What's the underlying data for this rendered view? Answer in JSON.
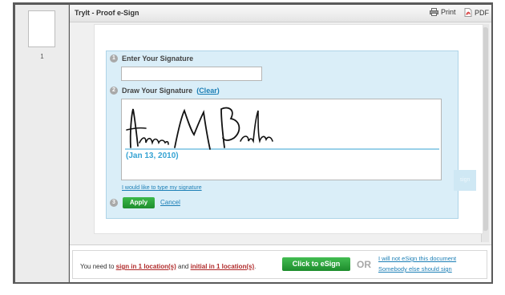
{
  "window": {
    "title": "TryIt - Proof e-Sign",
    "print_label": "Print",
    "pdf_label": "PDF"
  },
  "thumbnails": [
    {
      "page_number": "1"
    }
  ],
  "form": {
    "step1": {
      "number": "1",
      "label": "Enter Your Signature",
      "value": ""
    },
    "step2": {
      "number": "2",
      "label": "Draw Your Signature",
      "clear_open": "(",
      "clear_label": "Clear",
      "clear_close": ")",
      "signature_date": "(Jan 13, 2010)"
    },
    "type_link": "I would like to type my signature",
    "step3": {
      "number": "3",
      "apply_label": "Apply",
      "cancel_label": "Cancel"
    },
    "ghost_button_text": "sign"
  },
  "footer": {
    "prefix": "You need to ",
    "sign_link": "sign in 1 location(s)",
    "middle": " and ",
    "initial_link": "initial in 1 location(s)",
    "suffix": ".",
    "esign_button": "Click to eSign",
    "or_label": "OR",
    "not_esign_link": "I will not eSign this document",
    "someone_else_link": "Somebody else should sign"
  },
  "colors": {
    "accent_green": "#2ea33c",
    "link_blue": "#1c7fb6",
    "link_red": "#b02a2a",
    "panel_blue": "#daeef8",
    "date_blue": "#36a3d3"
  }
}
